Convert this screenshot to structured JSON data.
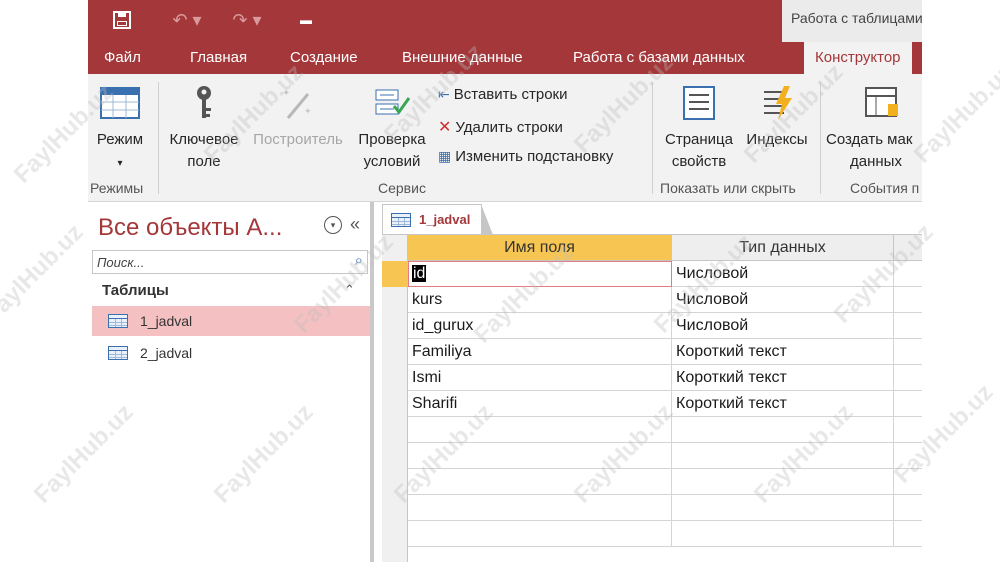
{
  "qat": {
    "title_context": "Работа с таблицами"
  },
  "tabs": [
    "Файл",
    "Главная",
    "Создание",
    "Внешние данные",
    "Работа с базами данных",
    "Конструктор"
  ],
  "ribbon": {
    "views": {
      "mode_label": "Режим",
      "group_label": "Режимы"
    },
    "tools": {
      "primary_key_label_1": "Ключевое",
      "primary_key_label_2": "поле",
      "builder_label": "Построитель",
      "validation_label_1": "Проверка",
      "validation_label_2": "условий",
      "insert_rows": "Вставить строки",
      "delete_rows": "Удалить строки",
      "modify_lookups": "Изменить подстановку",
      "group_label": "Сервис"
    },
    "show_hide": {
      "property_sheet_1": "Страница",
      "property_sheet_2": "свойств",
      "indexes": "Индексы",
      "group_label": "Показать или скрыть"
    },
    "events": {
      "create_macro_1": "Создать мак",
      "create_macro_2": "данных",
      "group_label": "События п"
    }
  },
  "nav": {
    "title": "Все объекты А...",
    "search_placeholder": "Поиск...",
    "group": "Таблицы",
    "items": [
      {
        "label": "1_jadval"
      },
      {
        "label": "2_jadval"
      }
    ]
  },
  "document": {
    "tab_label": "1_jadval",
    "columns": [
      "Имя поля",
      "Тип данных"
    ],
    "rows": [
      {
        "field": "id",
        "type": "Числовой"
      },
      {
        "field": "kurs",
        "type": "Числовой"
      },
      {
        "field": "id_gurux",
        "type": "Числовой"
      },
      {
        "field": "Familiya",
        "type": "Короткий текст"
      },
      {
        "field": "Ismi",
        "type": "Короткий текст"
      },
      {
        "field": "Sharifi",
        "type": "Короткий текст"
      }
    ]
  },
  "watermark": "FaylHub.uz",
  "colors": {
    "accent": "#a4373a",
    "header_selected": "#f7c652",
    "nav_selected": "#f5c0c2"
  }
}
